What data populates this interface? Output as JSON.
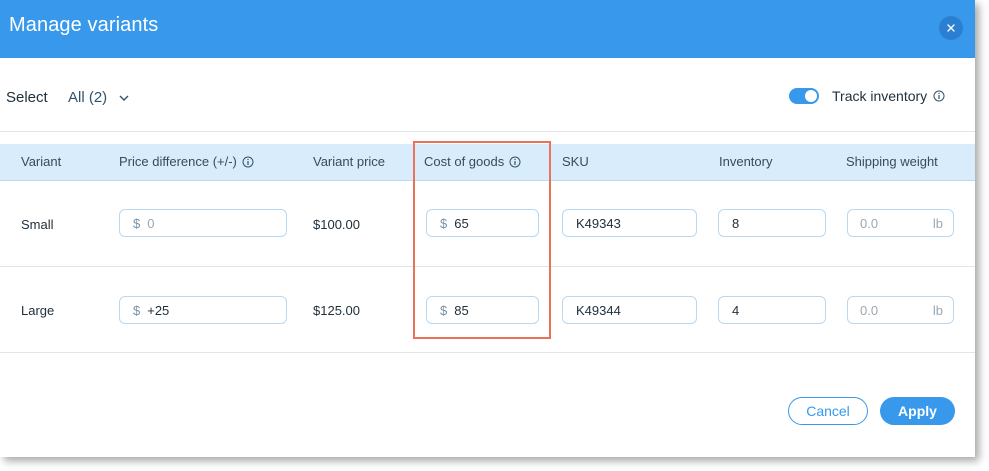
{
  "dialog": {
    "title": "Manage variants",
    "close_glyph": "×"
  },
  "select": {
    "label": "Select",
    "value": "All (2)"
  },
  "track_inventory": {
    "label": "Track inventory",
    "enabled": true
  },
  "table": {
    "headers": {
      "variant": "Variant",
      "price_difference": "Price difference (+/-)",
      "variant_price": "Variant price",
      "cost_of_goods": "Cost of goods",
      "sku": "SKU",
      "inventory": "Inventory",
      "shipping_weight": "Shipping weight"
    },
    "currency_symbol": "$",
    "weight_unit": "lb",
    "rows": [
      {
        "variant": "Small",
        "price_difference": "0",
        "variant_price": "$100.00",
        "cost_of_goods": "65",
        "sku": "K49343",
        "inventory": "8",
        "shipping_weight_placeholder": "0.0"
      },
      {
        "variant": "Large",
        "price_difference": "+25",
        "variant_price": "$125.00",
        "cost_of_goods": "85",
        "sku": "K49344",
        "inventory": "4",
        "shipping_weight_placeholder": "0.0"
      }
    ]
  },
  "footer": {
    "cancel_label": "Cancel",
    "apply_label": "Apply"
  },
  "colors": {
    "accent": "#3899ec",
    "header_row_bg": "#d9ecfb",
    "highlight_outline": "#e8735a"
  }
}
